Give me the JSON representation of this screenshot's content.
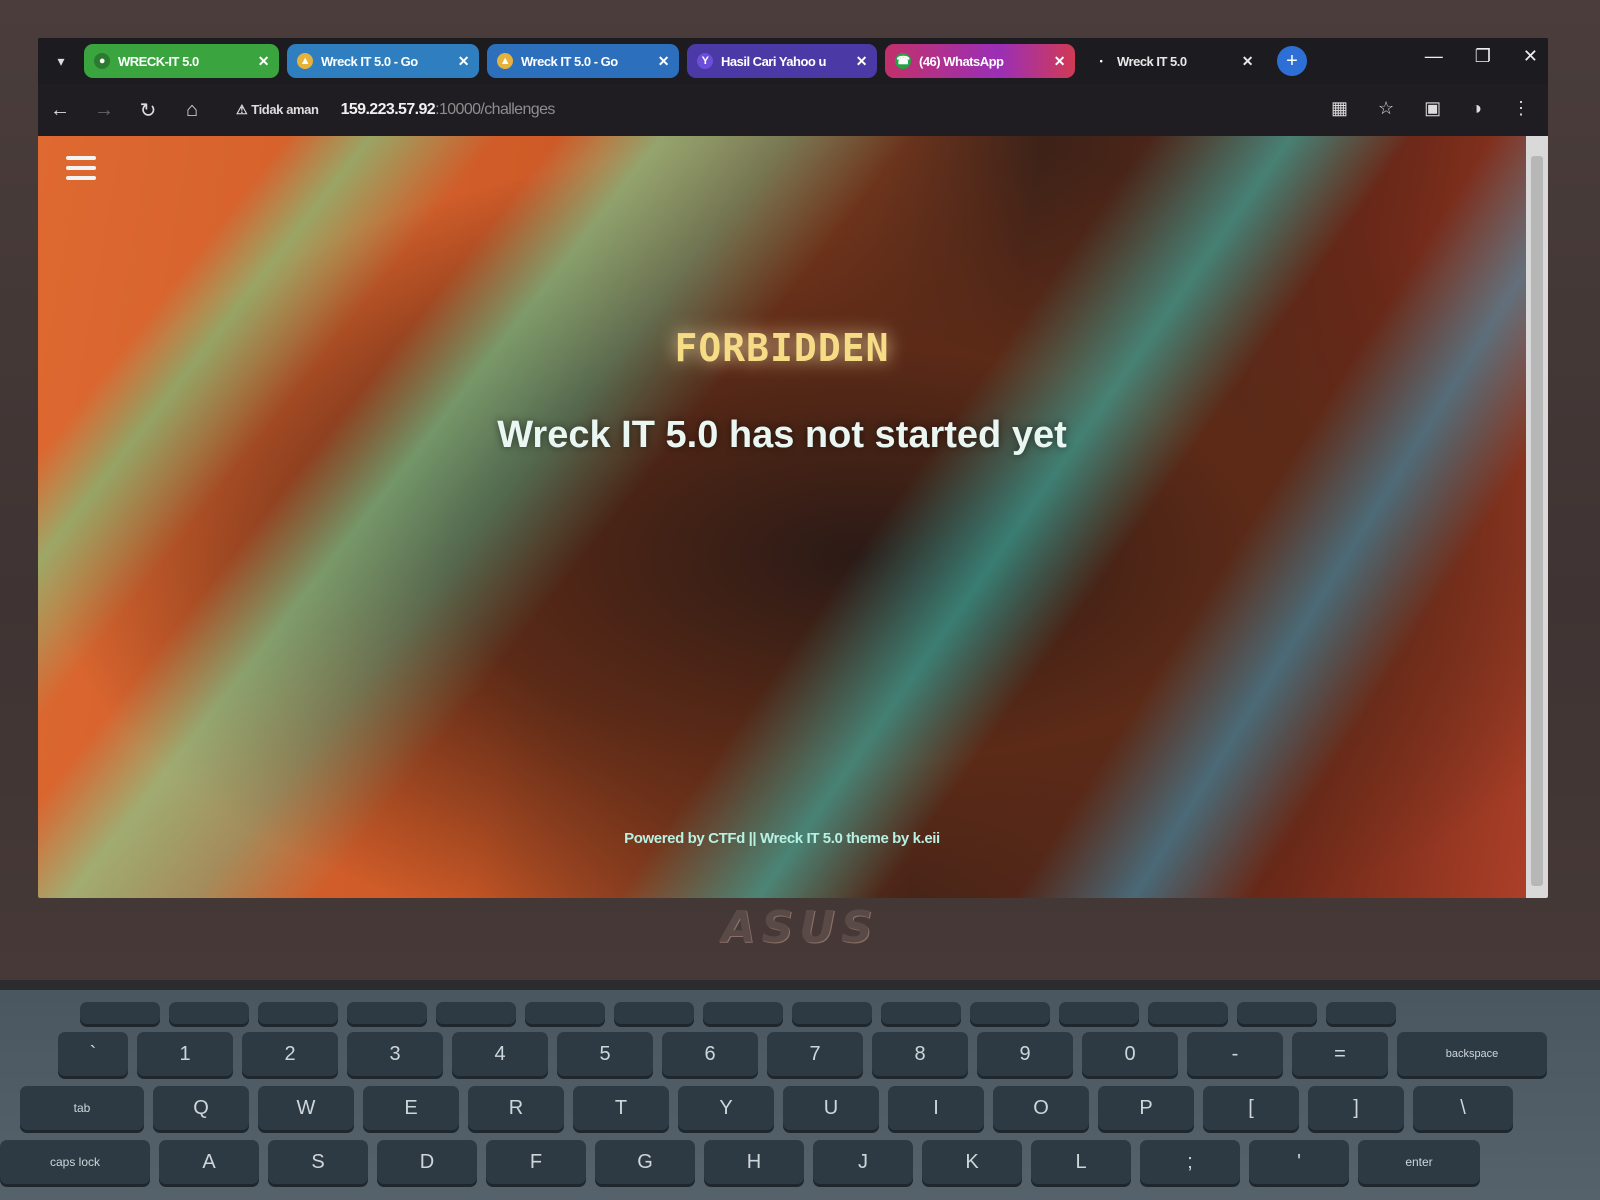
{
  "browser": {
    "tabs": [
      {
        "label": "WRECK-IT 5.0",
        "icon": "tab-favicon-icon"
      },
      {
        "label": "Wreck IT 5.0 - Go",
        "icon": "drive-icon"
      },
      {
        "label": "Wreck IT 5.0 - Go",
        "icon": "drive-icon"
      },
      {
        "label": "Hasil Cari Yahoo u",
        "icon": "yahoo-icon"
      },
      {
        "label": "(46) WhatsApp",
        "icon": "whatsapp-icon"
      },
      {
        "label": "Wreck IT 5.0",
        "icon": "loading-icon"
      }
    ],
    "new_tab": "+",
    "security": "Tidak aman",
    "url_host": "159.223.57.92",
    "url_path": ":10000/challenges"
  },
  "page": {
    "heading": "FORBIDDEN",
    "message": "Wreck IT 5.0 has not started yet",
    "footer": "Powered by CTFd || Wreck IT 5.0 theme by k.eii"
  },
  "laptop": {
    "logo": "ASUS"
  },
  "keyboard": {
    "row1": [
      "`",
      "1",
      "2",
      "3",
      "4",
      "5",
      "6",
      "7",
      "8",
      "9",
      "0",
      "-",
      "=",
      "backspace"
    ],
    "row2": [
      "tab",
      "Q",
      "W",
      "E",
      "R",
      "T",
      "Y",
      "U",
      "I",
      "O",
      "P",
      "[",
      "]",
      "\\"
    ],
    "row3": [
      "caps lock",
      "A",
      "S",
      "D",
      "F",
      "G",
      "H",
      "J",
      "K",
      "L",
      ";",
      "'",
      "enter"
    ]
  }
}
